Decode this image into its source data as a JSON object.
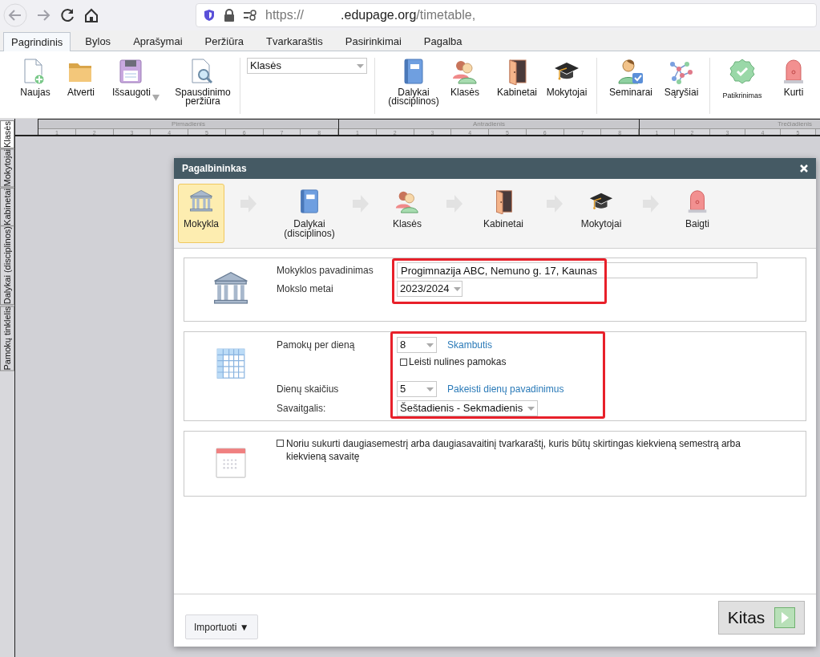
{
  "browser": {
    "url_scheme": "https://",
    "url_host": ".edupage.org",
    "url_path": "/timetable,"
  },
  "menu_tabs": [
    {
      "label": "Pagrindinis",
      "selected": true
    },
    {
      "label": "Bylos",
      "selected": false
    },
    {
      "label": "Aprašymai",
      "selected": false
    },
    {
      "label": "Peržiūra",
      "selected": false
    },
    {
      "label": "Tvarkaraštis",
      "selected": false
    },
    {
      "label": "Pasirinkimai",
      "selected": false
    },
    {
      "label": "Pagalba",
      "selected": false
    }
  ],
  "ribbon": {
    "file_buttons": [
      "Naujas",
      "Atverti",
      "Išsaugoti",
      "Spausdinimo peržiūra"
    ],
    "view_select": "Klasės",
    "data_buttons": [
      "Dalykai (disciplinos)",
      "Klasės",
      "Kabinetai",
      "Mokytojai"
    ],
    "extra_buttons": [
      "Seminarai",
      "Sąryšiai"
    ],
    "generate_buttons": [
      "Patikrinimas",
      "Kurti"
    ]
  },
  "timetable_header": {
    "days": [
      {
        "name": "Pirmadienis",
        "periods": [
          "1",
          "2",
          "3",
          "4",
          "5",
          "6",
          "7",
          "8"
        ]
      },
      {
        "name": "Antradienis",
        "periods": [
          "1",
          "2",
          "3",
          "4",
          "5",
          "6",
          "7",
          "8"
        ]
      },
      {
        "name": "Trečiadienis",
        "periods": [
          "1",
          "2",
          "3",
          "4",
          "5"
        ]
      }
    ]
  },
  "side_tabs": [
    {
      "label": "Klasės",
      "selected": true
    },
    {
      "label": "Mokytojai",
      "selected": false
    },
    {
      "label": "Kabinetai",
      "selected": false
    },
    {
      "label": "Dalykai (disciplinos)",
      "selected": false
    },
    {
      "label": "Pamokų tinklelis",
      "selected": false
    }
  ],
  "dialog": {
    "title": "Pagalbininkas",
    "steps": [
      {
        "label": "Mokykla",
        "selected": true
      },
      {
        "label": "Dalykai (disciplinos)",
        "selected": false
      },
      {
        "label": "Klasės",
        "selected": false
      },
      {
        "label": "Kabinetai",
        "selected": false
      },
      {
        "label": "Mokytojai",
        "selected": false
      },
      {
        "label": "Baigti",
        "selected": false
      }
    ],
    "school_name": {
      "label": "Mokyklos pavadinimas",
      "value": "Progimnazija ABC, Nemuno g. 17, Kaunas"
    },
    "school_year": {
      "label": "Mokslo metai",
      "value": "2023/2024"
    },
    "lessons_per_day": {
      "label": "Pamokų per dieną",
      "value": "8",
      "link": "Skambutis"
    },
    "zero_lessons": {
      "label": "Leisti nulines pamokas",
      "checked": false
    },
    "day_count": {
      "label": "Dienų skaičius",
      "value": "5",
      "link": "Pakeisti dienų pavadinimus"
    },
    "weekend": {
      "label": "Savaitgalis:",
      "value": "Šeštadienis - Sekmadienis"
    },
    "multi_term": {
      "label": "Noriu sukurti daugiasemestrį arba daugiasavaitinį tvarkaraštį, kuris būtų skirtingas kiekvieną semestrą arba kiekvieną savaitę",
      "checked": false
    },
    "import_button": "Importuoti ▼",
    "next_button": "Kitas"
  }
}
